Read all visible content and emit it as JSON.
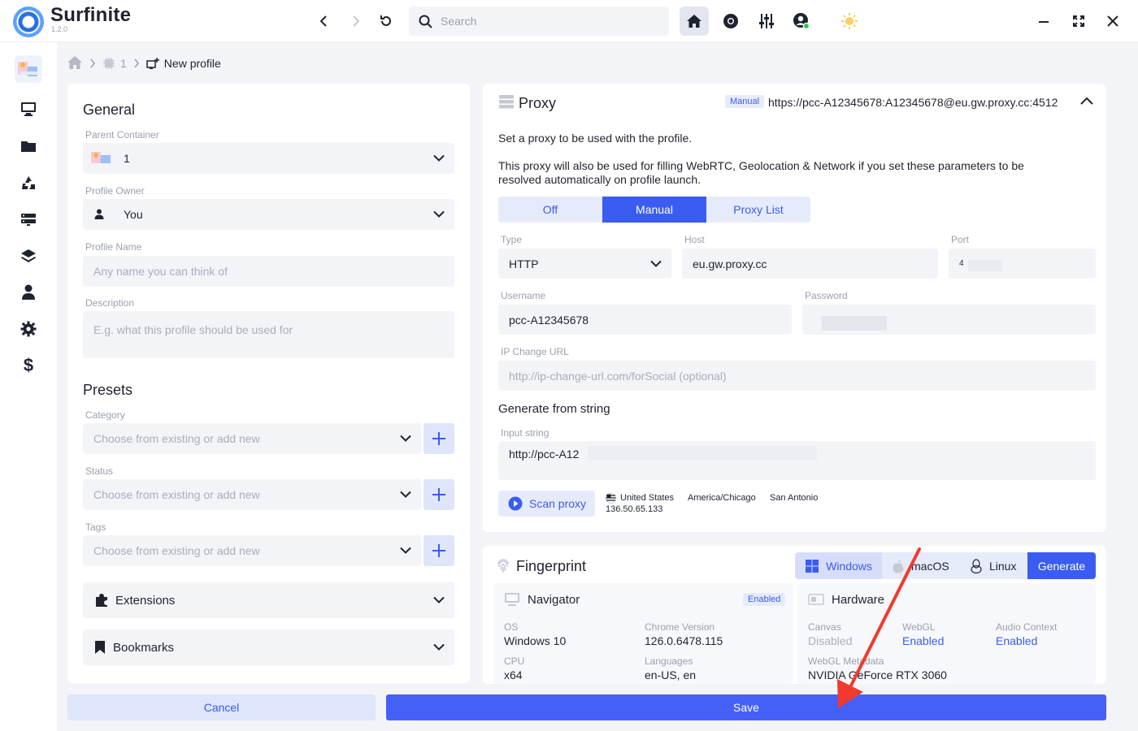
{
  "app": {
    "name": "Surfinite",
    "version": "1.2.0",
    "search_placeholder": "Search"
  },
  "breadcrumb": {
    "container": "1",
    "current": "New profile"
  },
  "general": {
    "title": "General",
    "parent_container_label": "Parent Container",
    "parent_container_value": "1",
    "profile_owner_label": "Profile Owner",
    "profile_owner_value": "You",
    "profile_name_label": "Profile Name",
    "profile_name_placeholder": "Any name you can think of",
    "description_label": "Description",
    "description_placeholder": "E.g. what this profile should be used for"
  },
  "presets": {
    "title": "Presets",
    "category_label": "Category",
    "status_label": "Status",
    "tags_label": "Tags",
    "select_placeholder": "Choose from existing or add new"
  },
  "accordions": {
    "extensions": "Extensions",
    "bookmarks": "Bookmarks"
  },
  "proxy": {
    "title": "Proxy",
    "mode_badge": "Manual",
    "summary_url": "https://pcc-A12345678:A12345678@eu.gw.proxy.cc:4512",
    "description_1": "Set a proxy to be used with the profile.",
    "description_2": "This proxy will also be used for filling WebRTC, Geolocation & Network if you set these parameters to be resolved automatically on profile launch.",
    "modes": [
      "Off",
      "Manual",
      "Proxy List"
    ],
    "active_mode": "Manual",
    "type_label": "Type",
    "type_value": "HTTP",
    "host_label": "Host",
    "host_value": "eu.gw.proxy.cc",
    "port_label": "Port",
    "port_value": "4",
    "username_label": "Username",
    "username_value": "pcc-A12345678",
    "password_label": "Password",
    "ip_change_label": "IP Change URL",
    "ip_change_placeholder": "http://ip-change-url.com/forSocial (optional)",
    "generate_title": "Generate from string",
    "input_string_label": "Input string",
    "input_string_value": "http://pcc-A12",
    "scan_label": "Scan proxy",
    "scan_result": {
      "country": "United States",
      "ip": "136.50.65.133",
      "timezone": "America/Chicago",
      "city": "San Antonio"
    }
  },
  "fingerprint": {
    "title": "Fingerprint",
    "os_tabs": [
      "Windows",
      "macOS",
      "Linux"
    ],
    "active_os": "Windows",
    "generate_label": "Generate",
    "navigator": {
      "title": "Navigator",
      "badge": "Enabled",
      "os_label": "OS",
      "os_value": "Windows 10",
      "chrome_label": "Chrome Version",
      "chrome_value": "126.0.6478.115",
      "cpu_label": "CPU",
      "cpu_value": "x64",
      "languages_label": "Languages",
      "languages_value": "en-US, en"
    },
    "hardware": {
      "title": "Hardware",
      "canvas_label": "Canvas",
      "canvas_value": "Disabled",
      "webgl_label": "WebGL",
      "webgl_value": "Enabled",
      "audio_label": "Audio Context",
      "audio_value": "Enabled",
      "webgl_meta_label": "WebGL Metadata",
      "webgl_meta_value": "NVIDIA GeForce RTX 3060"
    }
  },
  "footer": {
    "cancel": "Cancel",
    "save": "Save"
  },
  "colors": {
    "accent": "#3a5cf0",
    "save_button": "#4460f7",
    "annotation_arrow": "#f03a2e"
  }
}
